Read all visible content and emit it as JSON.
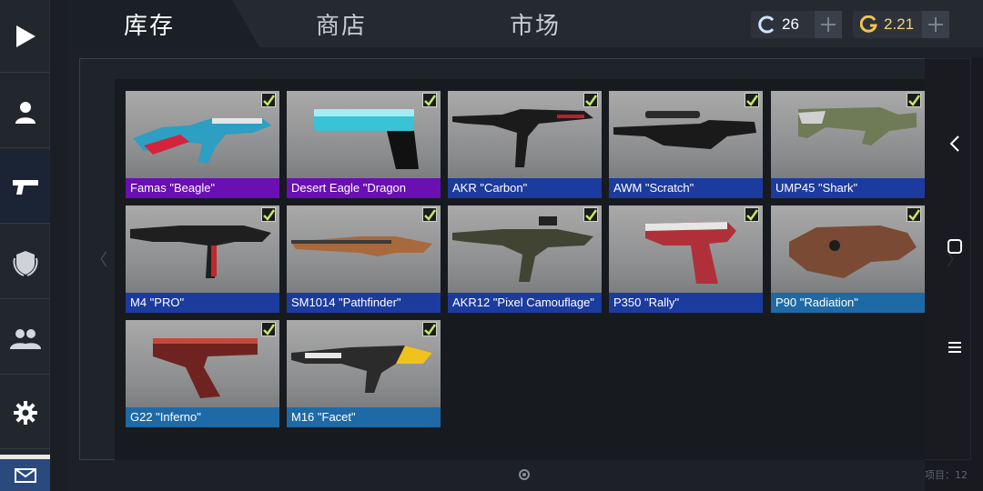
{
  "tabs": [
    {
      "label": "库存",
      "active": true
    },
    {
      "label": "商店",
      "active": false
    },
    {
      "label": "市场",
      "active": false
    }
  ],
  "currency": {
    "coins": {
      "icon": "c-coin-icon",
      "value": "26"
    },
    "gold": {
      "icon": "g-gold-icon",
      "value": "2.21"
    }
  },
  "sidebar": {
    "items": [
      {
        "name": "play",
        "icon": "play-icon"
      },
      {
        "name": "profile",
        "icon": "user-icon"
      },
      {
        "name": "weapons",
        "icon": "pistol-icon",
        "active": true
      },
      {
        "name": "clan",
        "icon": "shield-icon"
      },
      {
        "name": "friends",
        "icon": "friends-icon"
      },
      {
        "name": "settings",
        "icon": "gear-icon"
      },
      {
        "name": "mail",
        "icon": "mail-icon"
      }
    ]
  },
  "rarity_colors": {
    "purple": "#6a0fb3",
    "blue": "#1c3b9e",
    "lightblue": "#1e6aa6"
  },
  "items": [
    {
      "name": "Famas \"Beagle\"",
      "rarity": "purple",
      "color": "#6a0fb3"
    },
    {
      "name": "Desert Eagle \"Dragon",
      "rarity": "purple",
      "color": "#6a0fb3"
    },
    {
      "name": "AKR \"Carbon\"",
      "rarity": "blue",
      "color": "#1c3b9e"
    },
    {
      "name": "AWM \"Scratch\"",
      "rarity": "blue",
      "color": "#1c3b9e"
    },
    {
      "name": "UMP45 \"Shark\"",
      "rarity": "blue",
      "color": "#1c3b9e"
    },
    {
      "name": "M4 \"PRO\"",
      "rarity": "blue",
      "color": "#1c3b9e"
    },
    {
      "name": "SM1014 \"Pathfinder\"",
      "rarity": "blue",
      "color": "#1c3b9e"
    },
    {
      "name": "AKR12 \"Pixel Camouflage\"",
      "rarity": "blue",
      "color": "#1c3b9e"
    },
    {
      "name": "P350 \"Rally\"",
      "rarity": "blue",
      "color": "#1c3b9e"
    },
    {
      "name": "P90 \"Radiation\"",
      "rarity": "lightblue",
      "color": "#1e6aa6"
    },
    {
      "name": "G22 \"Inferno\"",
      "rarity": "lightblue",
      "color": "#1e6aa6"
    },
    {
      "name": "M16 \"Facet\"",
      "rarity": "lightblue",
      "color": "#1e6aa6"
    }
  ],
  "footer": {
    "item_count_label": "项目：12"
  },
  "nav": {
    "back_icon": "chevron-left-icon",
    "home_icon": "square-home-icon",
    "menu_icon": "hamburger-menu-icon",
    "left_arrow": "〈",
    "right_arrow": "〉"
  }
}
